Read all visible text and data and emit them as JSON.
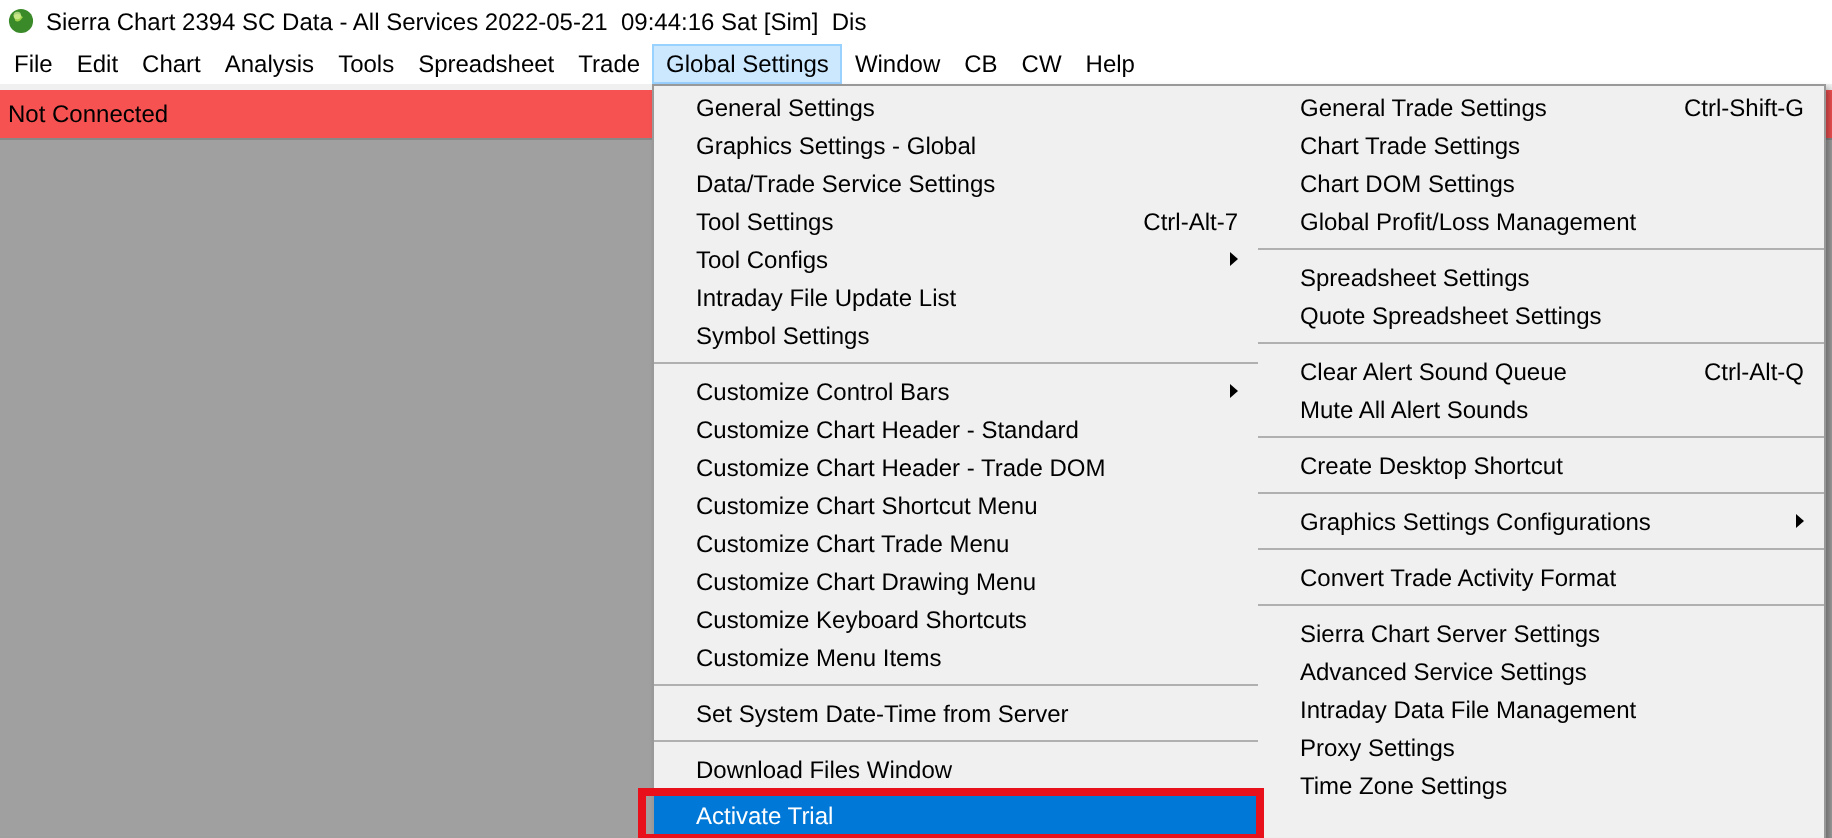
{
  "window": {
    "title": "Sierra Chart 2394 SC Data - All Services 2022-05-21  09:44:16 Sat [Sim]  Dis"
  },
  "menu_bar": [
    {
      "label": "File",
      "selected": false
    },
    {
      "label": "Edit",
      "selected": false
    },
    {
      "label": "Chart",
      "selected": false
    },
    {
      "label": "Analysis",
      "selected": false
    },
    {
      "label": "Tools",
      "selected": false
    },
    {
      "label": "Spreadsheet",
      "selected": false
    },
    {
      "label": "Trade",
      "selected": false
    },
    {
      "label": "Global Settings",
      "selected": true
    },
    {
      "label": "Window",
      "selected": false
    },
    {
      "label": "CB",
      "selected": false
    },
    {
      "label": "CW",
      "selected": false
    },
    {
      "label": "Help",
      "selected": false
    }
  ],
  "status": {
    "text": "Not Connected"
  },
  "dropdown": {
    "columns": [
      [
        [
          {
            "label": "General Settings",
            "selected": false,
            "submenu": false
          },
          {
            "label": "Graphics Settings - Global",
            "selected": false,
            "submenu": false
          },
          {
            "label": "Data/Trade Service Settings",
            "selected": false,
            "submenu": false
          },
          {
            "label": "Tool Settings",
            "shortcut": "Ctrl-Alt-7",
            "selected": false,
            "submenu": false
          },
          {
            "label": "Tool Configs",
            "selected": false,
            "submenu": true
          },
          {
            "label": "Intraday File Update List",
            "selected": false,
            "submenu": false
          },
          {
            "label": "Symbol Settings",
            "selected": false,
            "submenu": false
          }
        ],
        [
          {
            "label": "Customize Control Bars",
            "selected": false,
            "submenu": true
          },
          {
            "label": "Customize Chart Header - Standard",
            "selected": false,
            "submenu": false
          },
          {
            "label": "Customize Chart Header - Trade DOM",
            "selected": false,
            "submenu": false
          },
          {
            "label": "Customize Chart Shortcut Menu",
            "selected": false,
            "submenu": false
          },
          {
            "label": "Customize Chart Trade Menu",
            "selected": false,
            "submenu": false
          },
          {
            "label": "Customize Chart Drawing Menu",
            "selected": false,
            "submenu": false
          },
          {
            "label": "Customize Keyboard Shortcuts",
            "selected": false,
            "submenu": false
          },
          {
            "label": "Customize Menu Items",
            "selected": false,
            "submenu": false
          }
        ],
        [
          {
            "label": "Set System Date-Time from Server",
            "selected": false,
            "submenu": false
          }
        ],
        [
          {
            "label": "Download Files Window",
            "selected": false,
            "submenu": false
          },
          {
            "label": "Activate Trial",
            "selected": true,
            "submenu": false
          }
        ]
      ],
      [
        [
          {
            "label": "General Trade Settings",
            "shortcut": "Ctrl-Shift-G",
            "selected": false,
            "submenu": false
          },
          {
            "label": "Chart Trade Settings",
            "selected": false,
            "submenu": false
          },
          {
            "label": "Chart DOM Settings",
            "selected": false,
            "submenu": false
          },
          {
            "label": "Global Profit/Loss Management",
            "selected": false,
            "submenu": false
          }
        ],
        [
          {
            "label": "Spreadsheet Settings",
            "selected": false,
            "submenu": false
          },
          {
            "label": "Quote Spreadsheet Settings",
            "selected": false,
            "submenu": false
          }
        ],
        [
          {
            "label": "Clear Alert Sound Queue",
            "shortcut": "Ctrl-Alt-Q",
            "selected": false,
            "submenu": false
          },
          {
            "label": "Mute All Alert Sounds",
            "selected": false,
            "submenu": false
          }
        ],
        [
          {
            "label": "Create Desktop Shortcut",
            "selected": false,
            "submenu": false
          }
        ],
        [
          {
            "label": "Graphics Settings Configurations",
            "selected": false,
            "submenu": true
          }
        ],
        [
          {
            "label": "Convert Trade Activity Format",
            "selected": false,
            "submenu": false
          }
        ],
        [
          {
            "label": "Sierra Chart Server Settings",
            "selected": false,
            "submenu": false
          },
          {
            "label": "Advanced Service Settings",
            "selected": false,
            "submenu": false
          },
          {
            "label": "Intraday Data File Management",
            "selected": false,
            "submenu": false
          },
          {
            "label": "Proxy Settings",
            "selected": false,
            "submenu": false
          },
          {
            "label": "Time Zone Settings",
            "selected": false,
            "submenu": false
          }
        ]
      ]
    ]
  }
}
